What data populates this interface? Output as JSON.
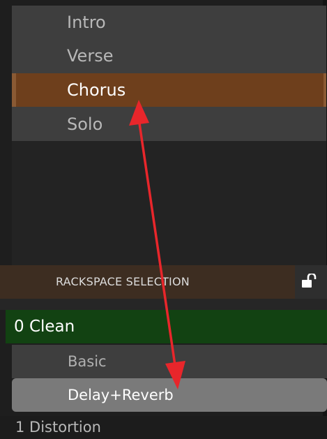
{
  "songs": {
    "parts": [
      "Intro",
      "Verse",
      "Chorus",
      "Solo"
    ],
    "selected_index": 2
  },
  "rackspace": {
    "header_label": "RACKSPACE SELECTION",
    "lock_icon": "unlock-icon",
    "groups": [
      {
        "label": "0  Clean",
        "variations": [
          "Basic",
          "Delay+Reverb"
        ],
        "selected_variation_index": 1
      },
      {
        "label": "1  Distortion"
      }
    ]
  },
  "annotation": {
    "arrow_color": "#e8262b",
    "arrow_icon": "double-headed-arrow"
  },
  "colors": {
    "selected_part": "#6e3f1c",
    "selected_group": "#124212",
    "selected_variation": "#7a7a7a"
  }
}
